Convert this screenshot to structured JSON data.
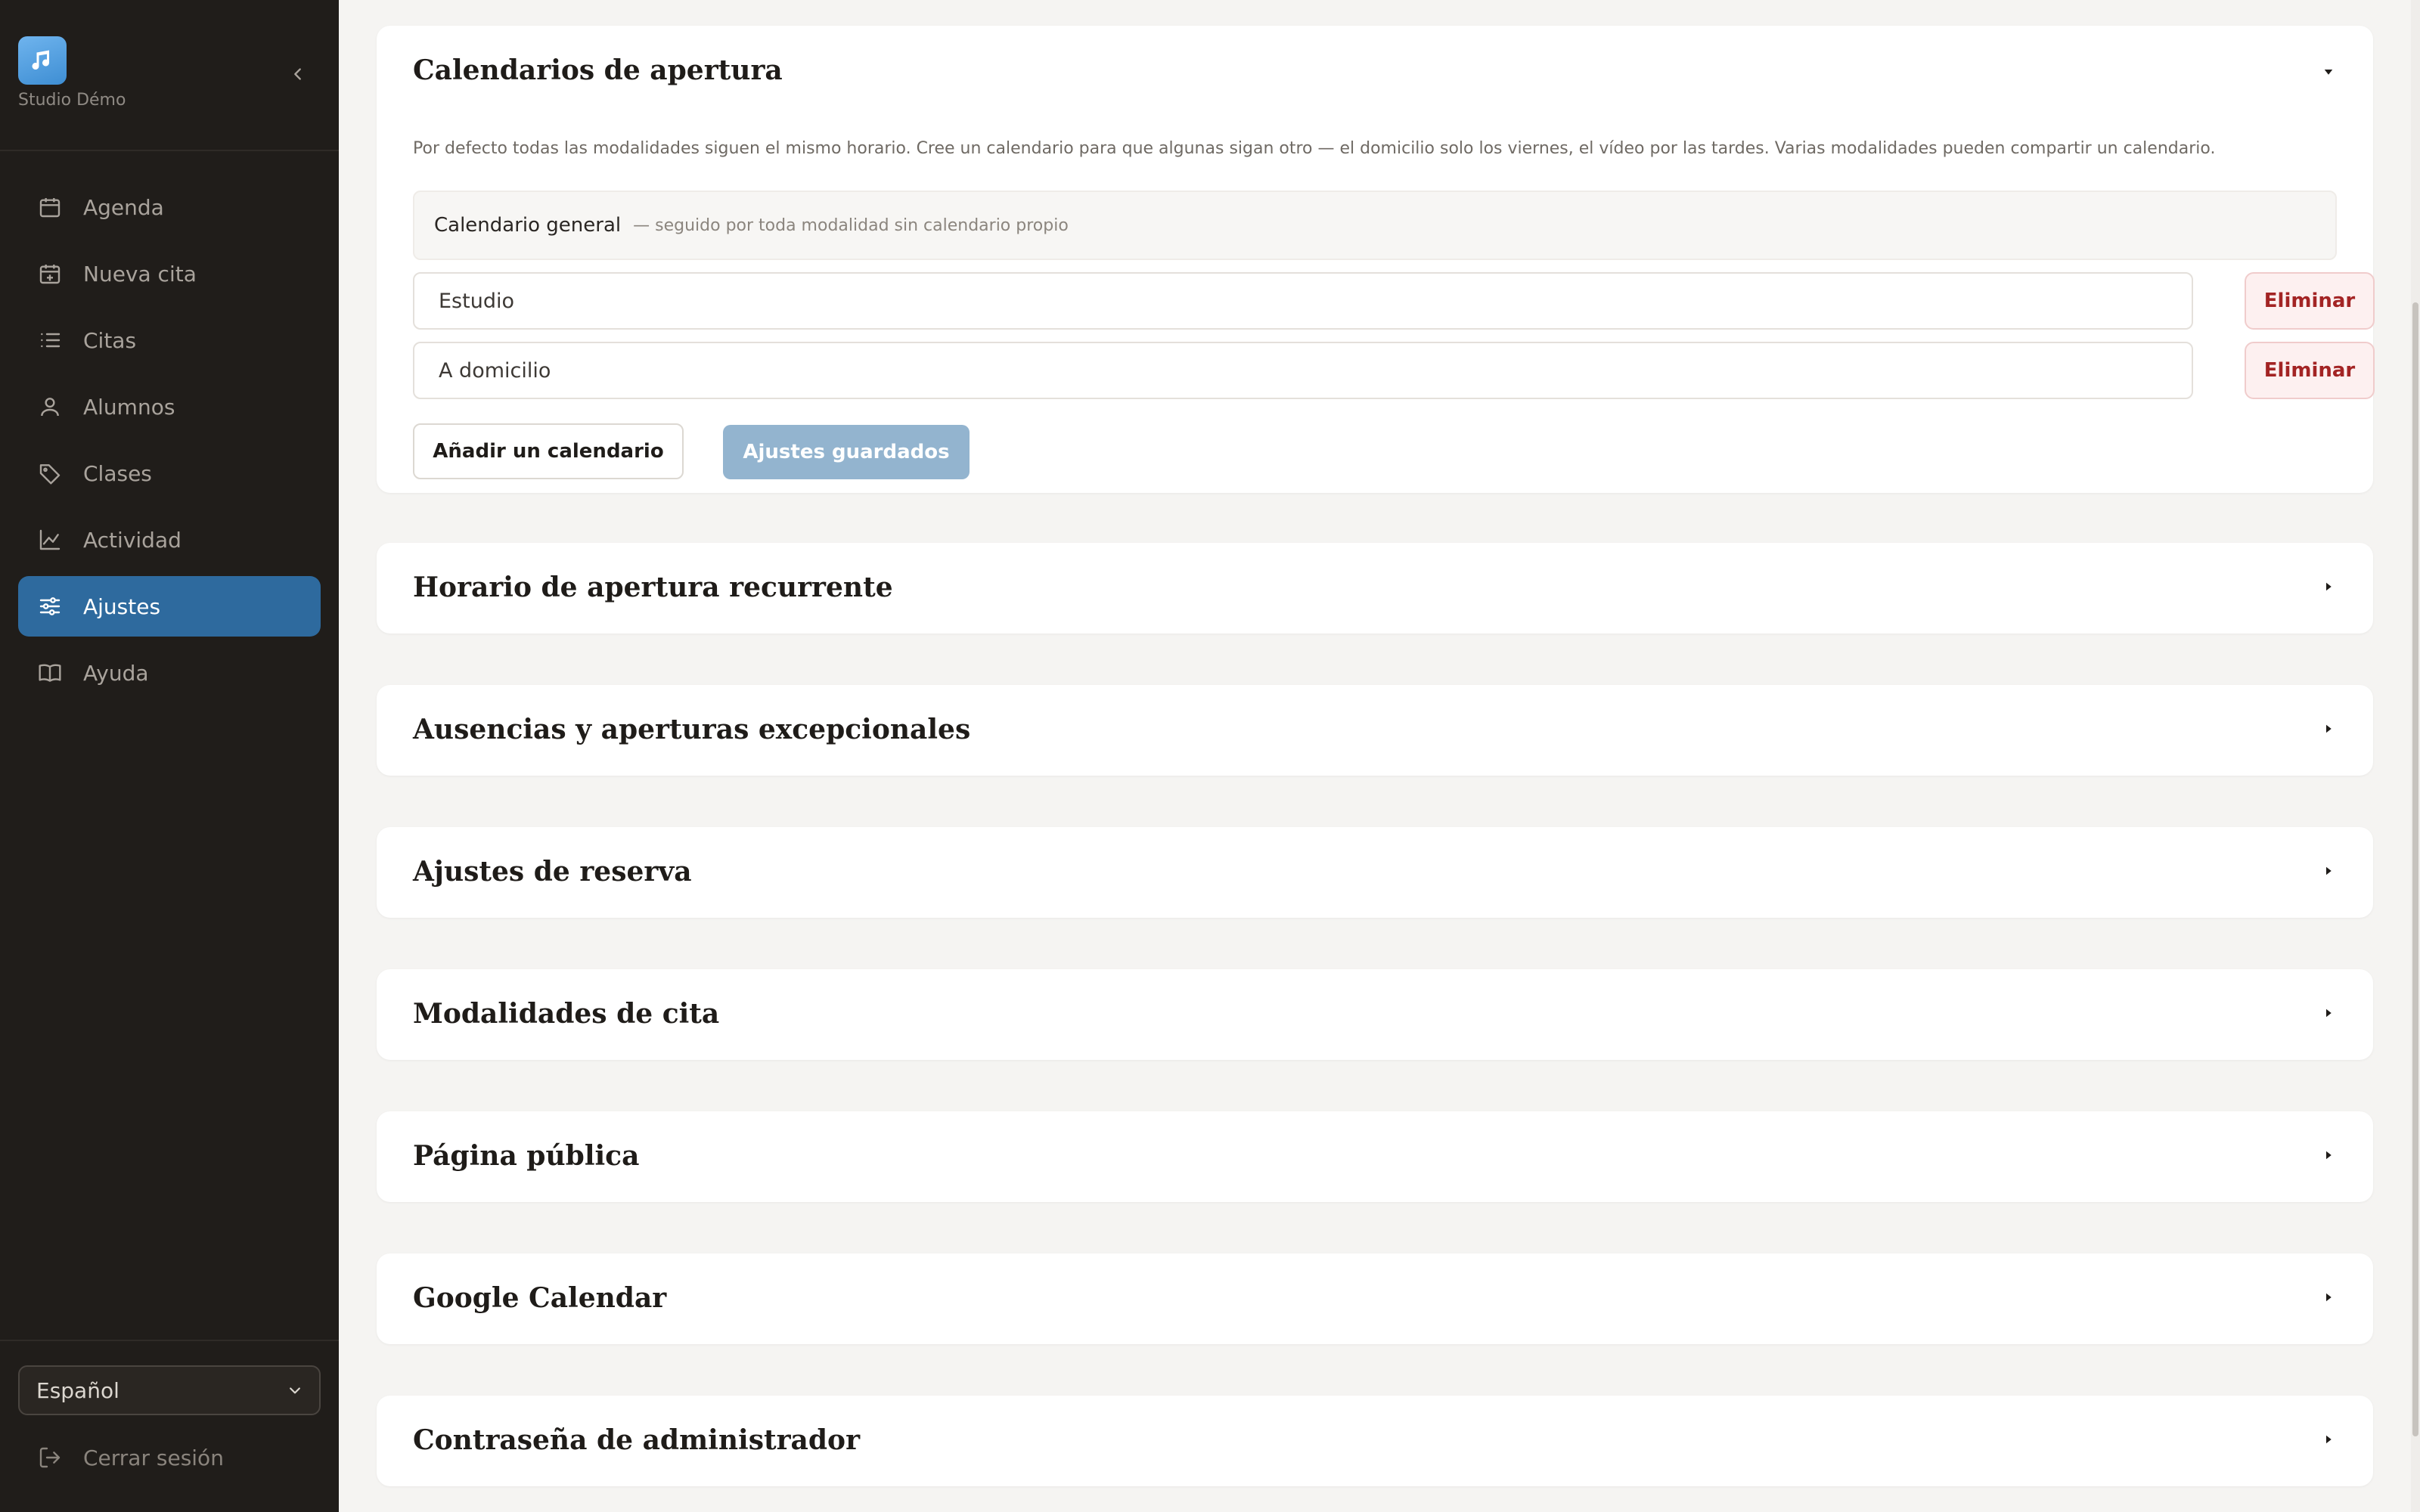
{
  "sidebar": {
    "brand_name": "Studio Démo",
    "items": [
      {
        "label": "Agenda",
        "icon": "calendar-icon"
      },
      {
        "label": "Nueva cita",
        "icon": "calendar-plus-icon"
      },
      {
        "label": "Citas",
        "icon": "list-icon"
      },
      {
        "label": "Alumnos",
        "icon": "user-icon"
      },
      {
        "label": "Clases",
        "icon": "tag-icon"
      },
      {
        "label": "Actividad",
        "icon": "chart-line-icon"
      },
      {
        "label": "Ajustes",
        "icon": "sliders-icon",
        "active": true
      },
      {
        "label": "Ayuda",
        "icon": "book-icon"
      }
    ],
    "language": "Español",
    "logout_label": "Cerrar sesión"
  },
  "main": {
    "calendars": {
      "title": "Calendarios de apertura",
      "description": "Por defecto todas las modalidades siguen el mismo horario. Cree un calendario para que algunas sigan otro — el domicilio solo los viernes, el vídeo por las tardes. Varias modalidades pueden compartir un calendario.",
      "general_label": "Calendario general",
      "general_hint": "— seguido por toda modalidad sin calendario propio",
      "entries": [
        {
          "name": "Estudio",
          "delete_label": "Eliminar"
        },
        {
          "name": "A domicilio",
          "delete_label": "Eliminar"
        }
      ],
      "add_label": "Añadir un calendario",
      "save_label": "Ajustes guardados"
    },
    "sections": [
      {
        "title": "Horario de apertura recurrente"
      },
      {
        "title": "Ausencias y aperturas excepcionales"
      },
      {
        "title": "Ajustes de reserva"
      },
      {
        "title": "Modalidades de cita"
      },
      {
        "title": "Página pública"
      },
      {
        "title": "Google Calendar"
      },
      {
        "title": "Contraseña de administrador"
      }
    ]
  },
  "colors": {
    "sidebar_bg": "#201d1a",
    "accent": "#2e6a9e",
    "danger": "#a32424",
    "page_bg": "#f5f4f2"
  }
}
